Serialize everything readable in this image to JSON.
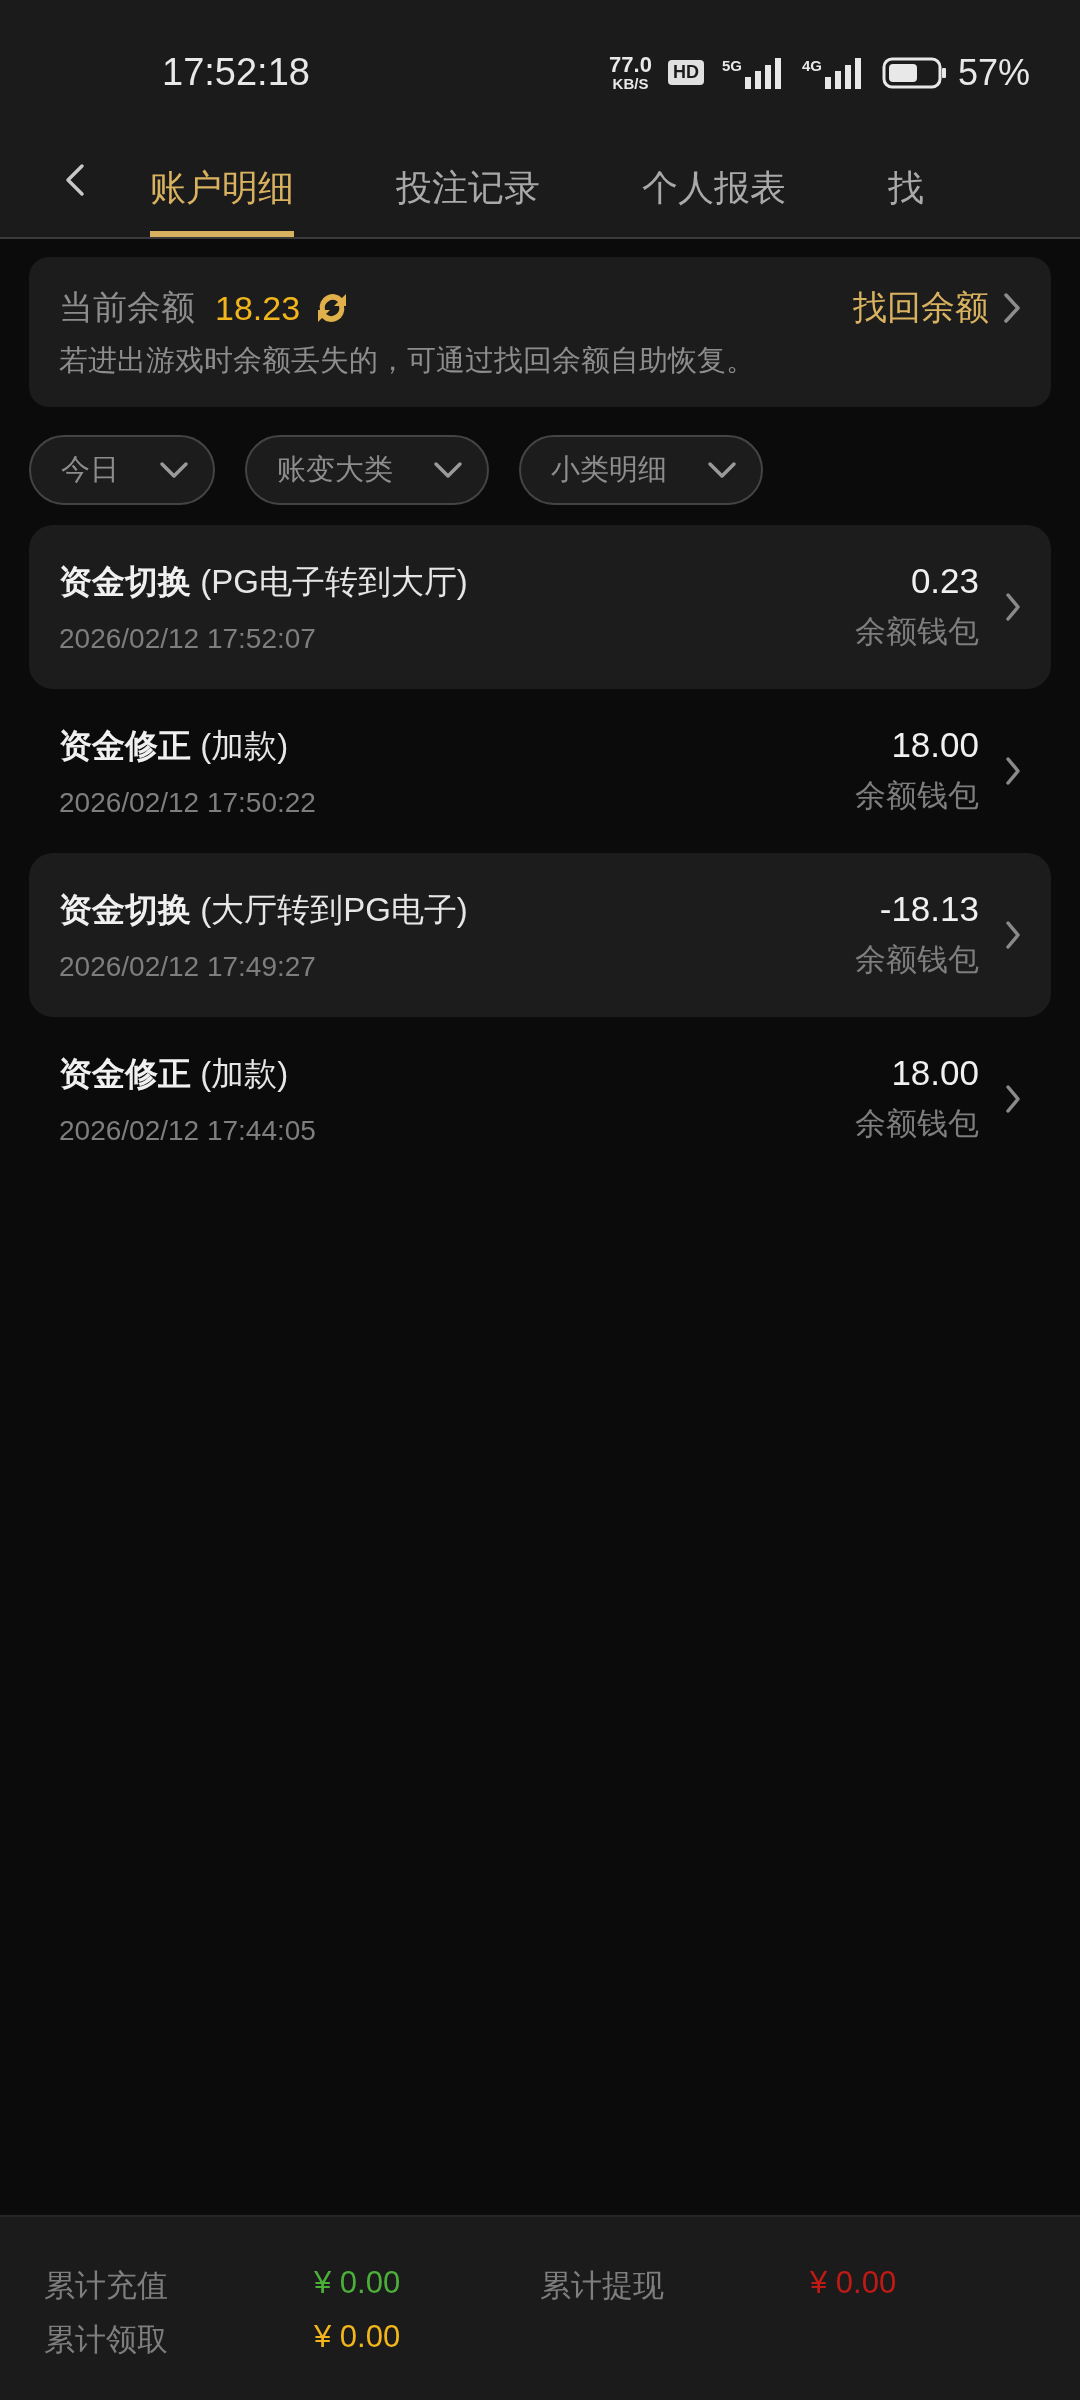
{
  "status_bar": {
    "time": "17:52:18",
    "net_speed": "77.0",
    "net_unit": "KB/S",
    "hd": "HD",
    "signals": [
      {
        "label": "5G"
      },
      {
        "label": "4G"
      }
    ],
    "battery": "57%"
  },
  "tabs": [
    {
      "label": "账户明细",
      "selected": true
    },
    {
      "label": "投注记录",
      "selected": false
    },
    {
      "label": "个人报表",
      "selected": false
    },
    {
      "label": "找",
      "selected": false
    }
  ],
  "balance_card": {
    "label": "当前余额",
    "amount": "18.23",
    "action": "找回余额",
    "hint": "若进出游戏时余额丢失的，可通过找回余额自助恢复。"
  },
  "filters": [
    {
      "label": "今日"
    },
    {
      "label": "账变大类"
    },
    {
      "label": "小类明细"
    }
  ],
  "records": [
    {
      "title": "**资金切换** (PG电子转到大厅)",
      "time": "2026/02/12 17:52:07",
      "amount": "0.23",
      "wallet": "余额钱包",
      "shaded": true
    },
    {
      "title": "**资金修正** (加款)",
      "time": "2026/02/12 17:50:22",
      "amount": "18.00",
      "wallet": "余额钱包",
      "shaded": false
    },
    {
      "title": "**资金切换** (大厅转到PG电子)",
      "time": "2026/02/12 17:49:27",
      "amount": "-18.13",
      "wallet": "余额钱包",
      "shaded": true
    },
    {
      "title": "**资金修正** (加款)",
      "time": "2026/02/12 17:44:05",
      "amount": "18.00",
      "wallet": "余额钱包",
      "shaded": false
    }
  ],
  "totals": [
    {
      "label": "累计充值",
      "value": "¥ 0.00",
      "color": "#4caf3a"
    },
    {
      "label": "累计提现",
      "value": "¥ 0.00",
      "color": "#c01a16"
    },
    {
      "label": "累计领取",
      "value": "¥ 0.00",
      "color": "#f2b51c"
    }
  ]
}
